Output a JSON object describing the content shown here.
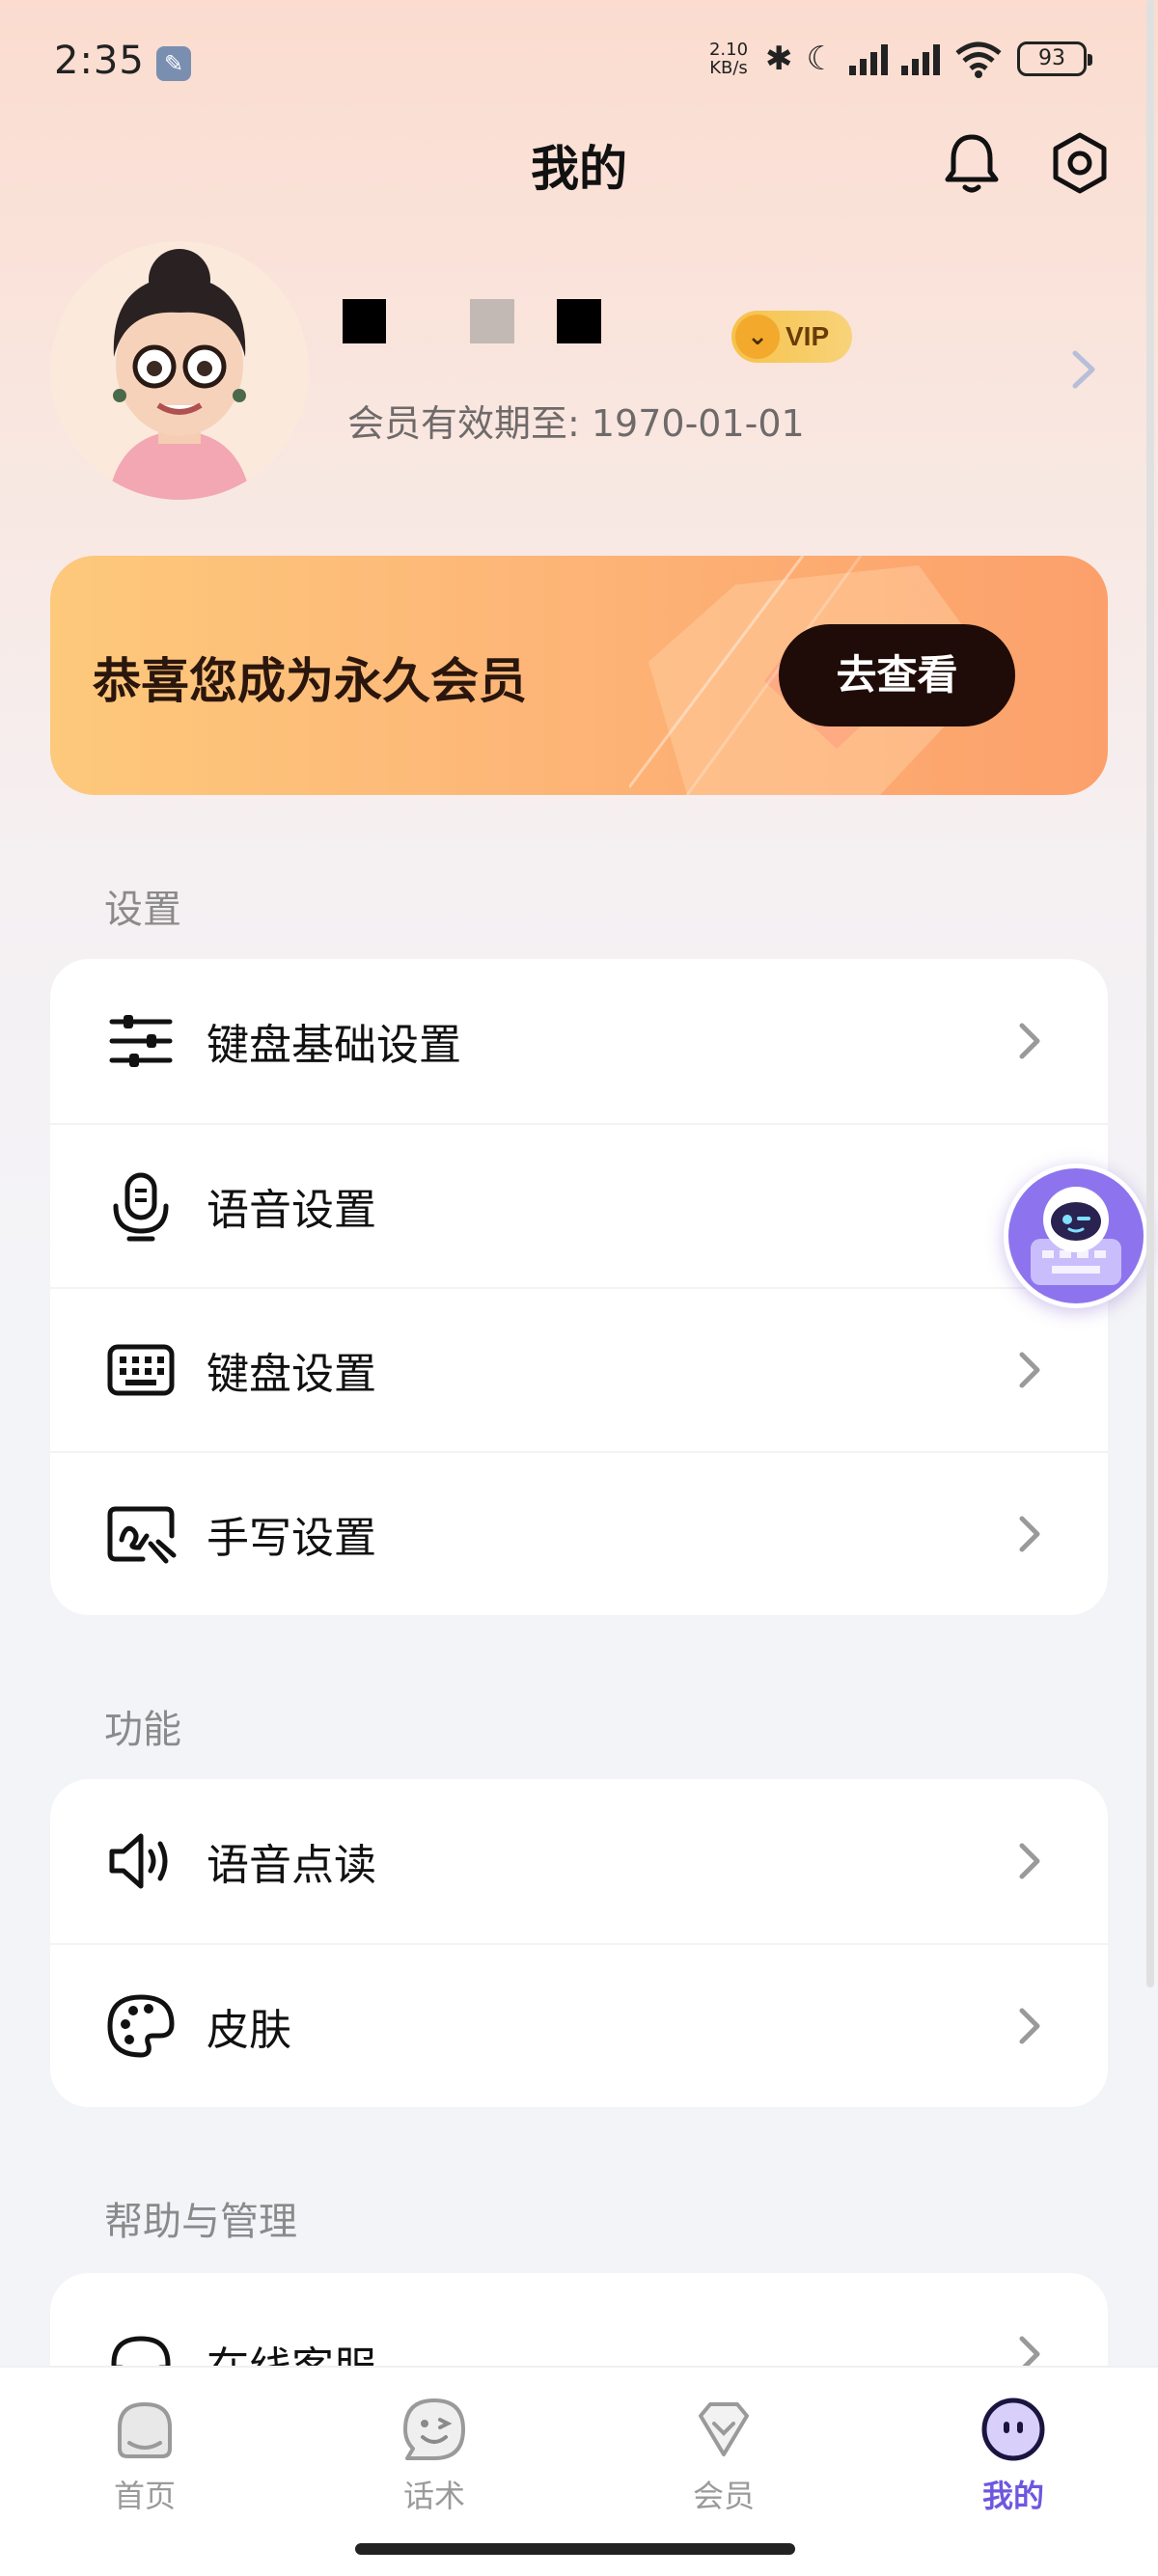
{
  "status_bar": {
    "time": "2:35",
    "net_speed_value": "2.10",
    "net_speed_unit": "KB/s",
    "battery": "93"
  },
  "header": {
    "title": "我的"
  },
  "profile": {
    "vip_label": "VIP",
    "expiry": "会员有效期至: 1970-01-01"
  },
  "banner": {
    "text": "恭喜您成为永久会员",
    "button_label": "去查看"
  },
  "sections": {
    "settings": {
      "title": "设置",
      "items": [
        {
          "label": "键盘基础设置",
          "icon": "sliders-icon"
        },
        {
          "label": "语音设置",
          "icon": "microphone-icon"
        },
        {
          "label": "键盘设置",
          "icon": "keyboard-icon"
        },
        {
          "label": "手写设置",
          "icon": "handwriting-icon"
        }
      ]
    },
    "features": {
      "title": "功能",
      "items": [
        {
          "label": "语音点读",
          "icon": "speaker-icon"
        },
        {
          "label": "皮肤",
          "icon": "palette-icon"
        }
      ]
    },
    "help": {
      "title": "帮助与管理",
      "items": [
        {
          "label": "在线客服",
          "icon": "headset-icon"
        }
      ]
    }
  },
  "bottom_nav": {
    "items": [
      {
        "label": "首页",
        "icon": "home-icon"
      },
      {
        "label": "话术",
        "icon": "chat-face-icon"
      },
      {
        "label": "会员",
        "icon": "vip-diamond-icon"
      },
      {
        "label": "我的",
        "icon": "profile-icon",
        "active": true
      }
    ]
  },
  "colors": {
    "accent": "#6e57e0",
    "banner_button": "#1f0c08",
    "vip_gold": "#f6c24a"
  }
}
